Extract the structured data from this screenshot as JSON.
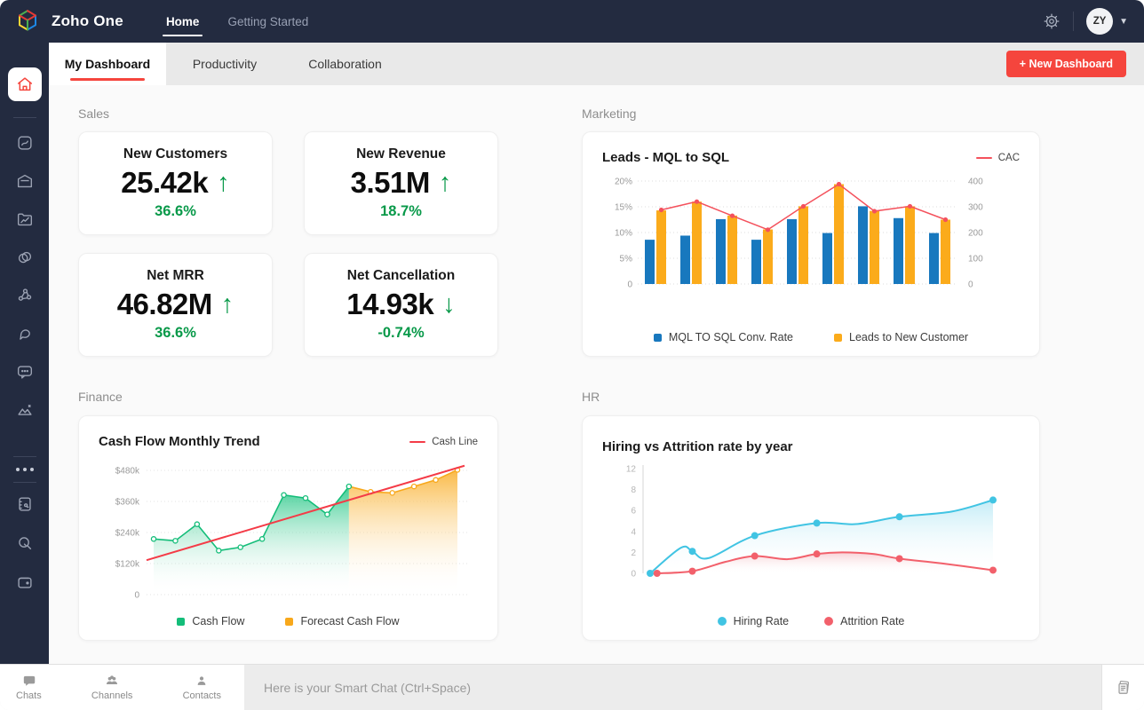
{
  "topbar": {
    "brand": "Zoho One",
    "nav": [
      {
        "label": "Home",
        "active": true
      },
      {
        "label": "Getting Started",
        "active": false
      }
    ],
    "avatar": "ZY"
  },
  "tabs": {
    "items": [
      {
        "label": "My Dashboard",
        "active": true
      },
      {
        "label": "Productivity",
        "active": false
      },
      {
        "label": "Collaboration",
        "active": false
      }
    ],
    "new_button": "+ New Dashboard"
  },
  "sections": {
    "sales": "Sales",
    "marketing": "Marketing",
    "finance": "Finance",
    "hr": "HR"
  },
  "kpis": [
    {
      "title": "New Customers",
      "value": "25.42k",
      "arrow": "↑",
      "delta": "36.6%"
    },
    {
      "title": "New Revenue",
      "value": "3.51M",
      "arrow": "↑",
      "delta": "18.7%"
    },
    {
      "title": "Net MRR",
      "value": "46.82M",
      "arrow": "↑",
      "delta": "36.6%"
    },
    {
      "title": "Net Cancellation",
      "value": "14.93k",
      "arrow": "↓",
      "delta": "-0.74%"
    }
  ],
  "theme": {
    "accent_red": "#f5453d",
    "positive_green": "#089949",
    "topbar_bg": "#232b40"
  },
  "chart_data": [
    {
      "id": "marketing",
      "type": "bar",
      "title": "Leads - MQL to SQL",
      "left_axis": {
        "ticks": [
          "20%",
          "15%",
          "10%",
          "5%",
          "0"
        ],
        "max": 20
      },
      "right_axis": {
        "ticks": [
          "400",
          "300",
          "200",
          "100",
          "0"
        ],
        "max": 400
      },
      "x_labels": [],
      "series": [
        {
          "name": "MQL TO SQL Conv. Rate",
          "type": "bar",
          "axis": "left",
          "color": "#1878be",
          "values": [
            8.6,
            9.4,
            12.6,
            8.6,
            12.6,
            9.9,
            15.1,
            12.8,
            9.9
          ]
        },
        {
          "name": "Leads to New Customer",
          "type": "bar",
          "axis": "left",
          "color": "#fbab1b",
          "values": [
            14.3,
            16.0,
            13.3,
            10.6,
            15.1,
            19.4,
            14.2,
            15.1,
            12.5
          ]
        },
        {
          "name": "CAC",
          "type": "line",
          "axis": "right",
          "color": "#f4515c",
          "values": [
            288,
            320,
            265,
            211,
            302,
            388,
            283,
            302,
            250
          ]
        }
      ],
      "legend_position": "bottom"
    },
    {
      "id": "finance",
      "type": "area",
      "title": "Cash Flow Monthly Trend",
      "y_axis": {
        "ticks": [
          "$480k",
          "$360k",
          "$240k",
          "$120k",
          "0"
        ],
        "max": 480,
        "unit": "k$"
      },
      "series": [
        {
          "name": "Cash Flow",
          "type": "area",
          "color": "#14bd79",
          "values": [
            215,
            208,
            272,
            170,
            183,
            215,
            385,
            373,
            310,
            418
          ],
          "start_index": 0
        },
        {
          "name": "Forecast Cash Flow",
          "type": "area",
          "color": "#f8a81b",
          "values": [
            418,
            397,
            393,
            418,
            443,
            482
          ],
          "start_index": 9
        },
        {
          "name": "Cash Line",
          "type": "trendline",
          "color": "#f43b47",
          "endpoints": [
            133,
            498
          ]
        }
      ],
      "legend_position": "bottom"
    },
    {
      "id": "hr",
      "type": "line",
      "title": "Hiring vs Attrition rate by year",
      "y_axis": {
        "ticks": [
          12,
          8,
          6,
          4,
          2,
          0
        ]
      },
      "series": [
        {
          "name": "Hiring Rate",
          "color": "#41c4e3",
          "x_frac": [
            0,
            0.123,
            0.305,
            0.486,
            0.727,
            1
          ],
          "values": [
            0,
            2.1,
            3.6,
            4.8,
            5.4,
            7.0
          ],
          "curve": [
            [
              0,
              0
            ],
            [
              0.09,
              2.45
            ],
            [
              0.123,
              2.1
            ],
            [
              0.17,
              1.45
            ],
            [
              0.305,
              3.6
            ],
            [
              0.486,
              4.8
            ],
            [
              0.6,
              4.7
            ],
            [
              0.727,
              5.4
            ],
            [
              0.88,
              5.9
            ],
            [
              1,
              7.0
            ]
          ]
        },
        {
          "name": "Attrition Rate",
          "color": "#f2606b",
          "x_frac": [
            0.02,
            0.123,
            0.305,
            0.486,
            0.727,
            1
          ],
          "values": [
            0,
            0.2,
            1.65,
            1.85,
            1.4,
            0.3
          ],
          "curve": [
            [
              0.02,
              0
            ],
            [
              0.123,
              0.2
            ],
            [
              0.22,
              1.1
            ],
            [
              0.305,
              1.65
            ],
            [
              0.4,
              1.35
            ],
            [
              0.486,
              1.85
            ],
            [
              0.56,
              2.0
            ],
            [
              0.65,
              1.85
            ],
            [
              0.727,
              1.4
            ],
            [
              0.85,
              0.95
            ],
            [
              1,
              0.3
            ]
          ]
        }
      ],
      "legend_position": "bottom"
    }
  ],
  "bottombar": {
    "tabs": [
      {
        "label": "Chats"
      },
      {
        "label": "Channels"
      },
      {
        "label": "Contacts"
      }
    ],
    "placeholder": "Here is your Smart Chat (Ctrl+Space)"
  }
}
